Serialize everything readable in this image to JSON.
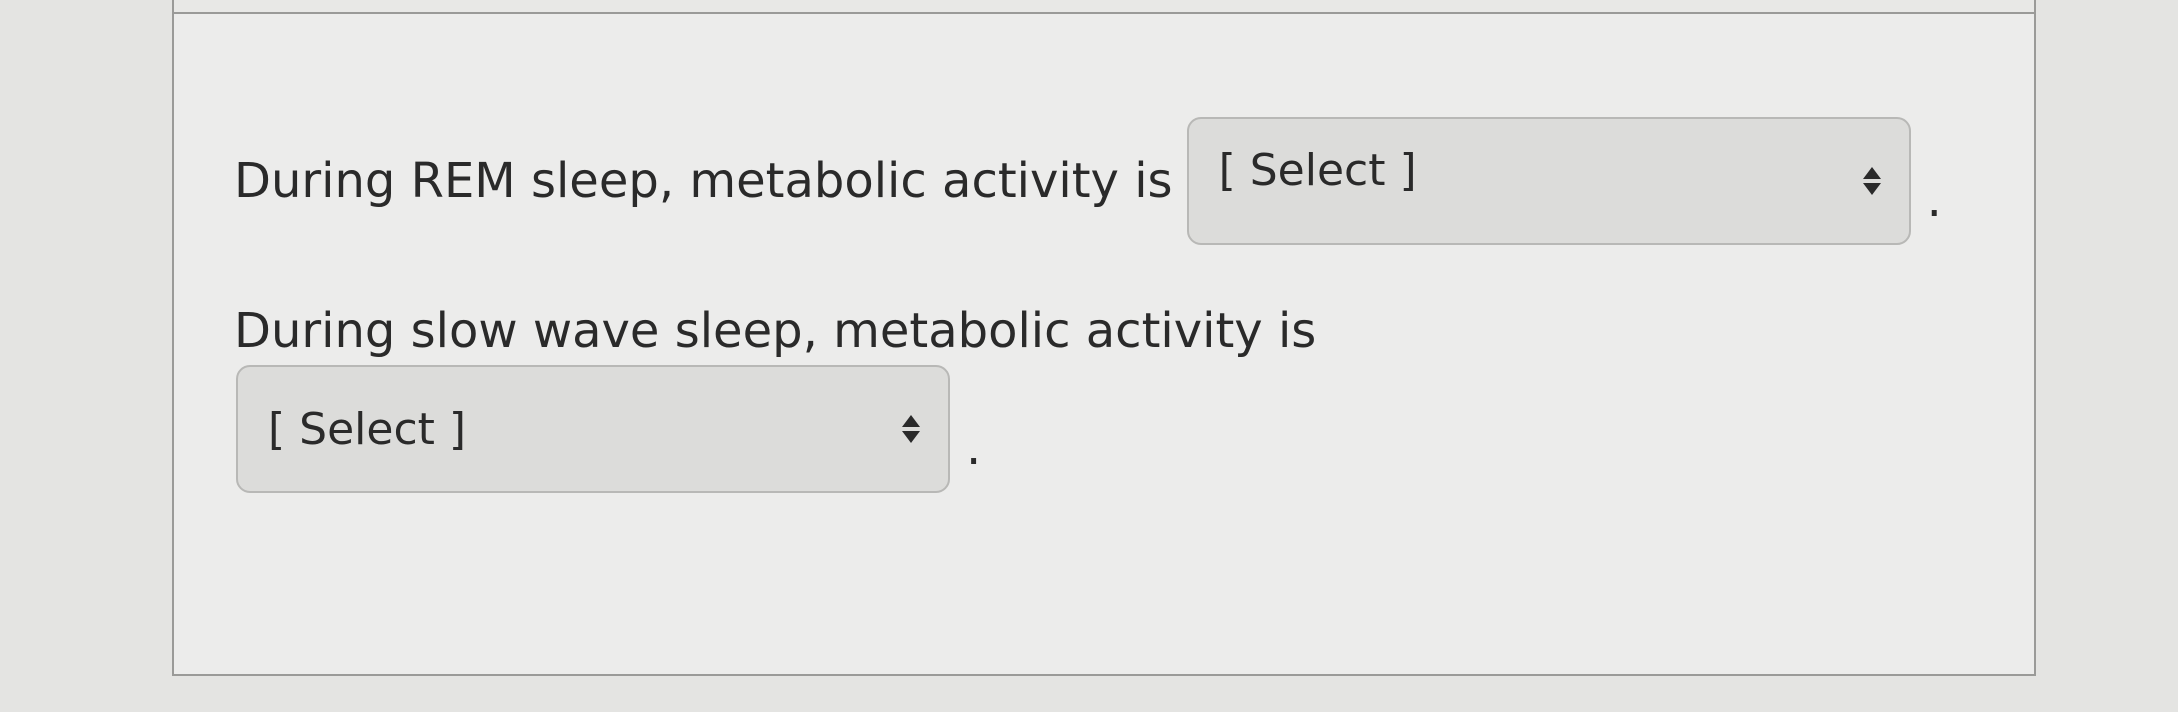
{
  "questions": [
    {
      "prompt": "During REM sleep, metabolic activity is",
      "select_value": "[ Select ]",
      "suffix": "."
    },
    {
      "prompt": "During slow wave sleep, metabolic activity is",
      "select_value": "[ Select ]",
      "suffix": "."
    }
  ],
  "colors": {
    "panel_background": "#ececeb",
    "select_background": "#dcdcda",
    "text": "#2a2a2a"
  }
}
